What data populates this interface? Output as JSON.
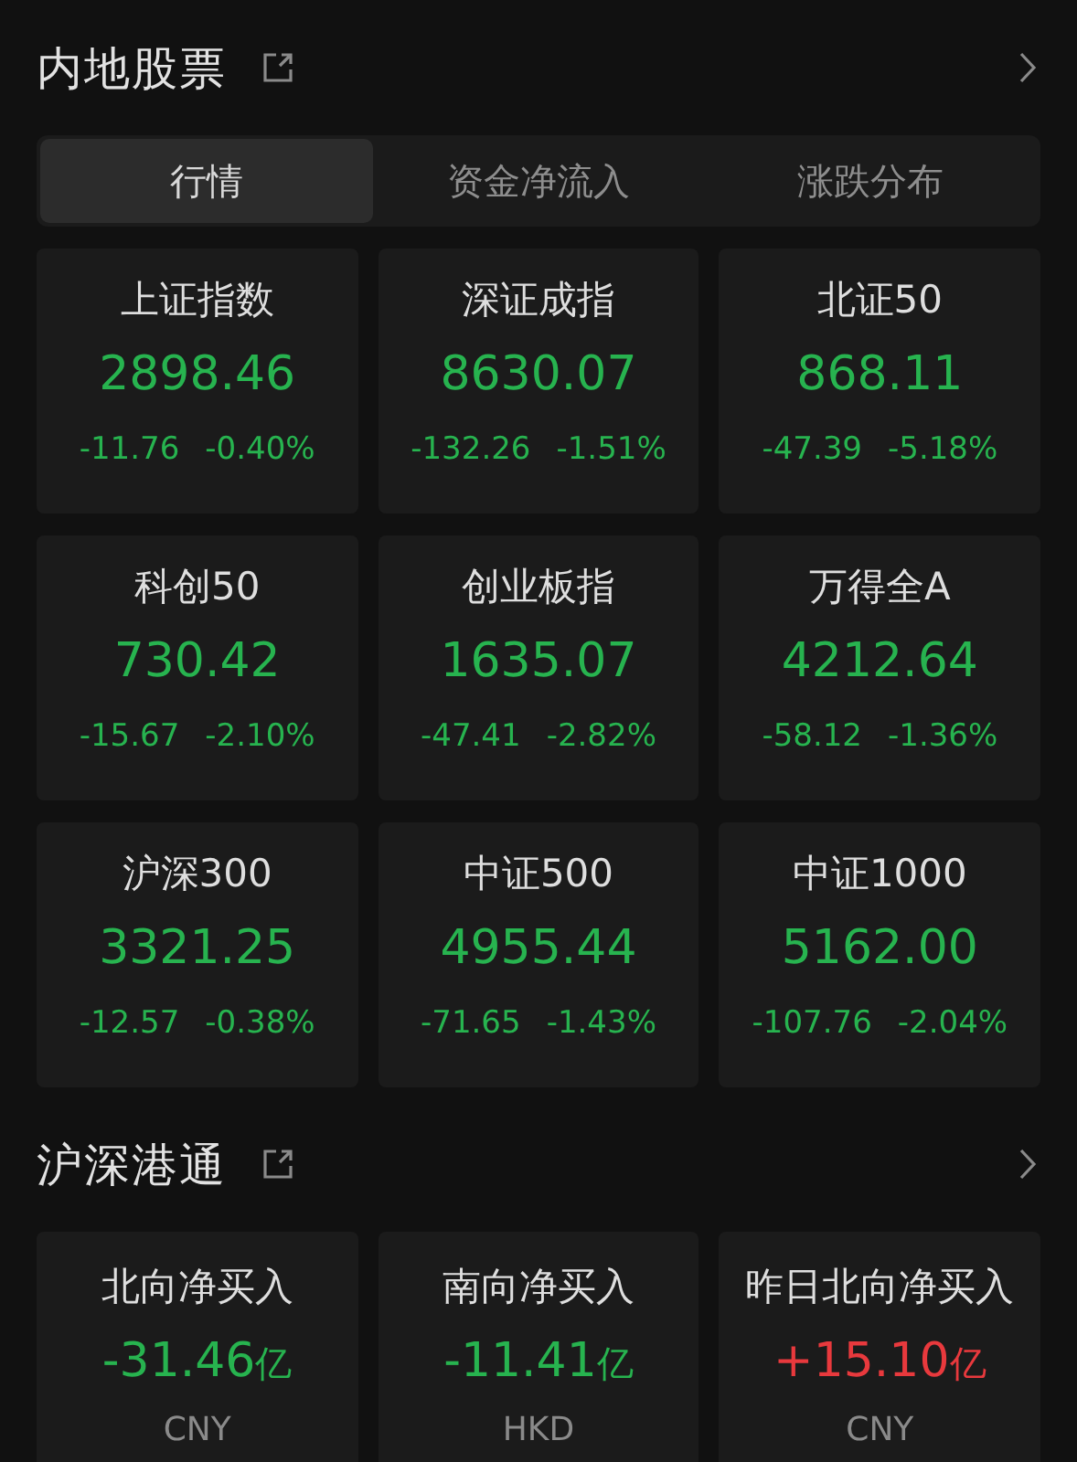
{
  "sections": [
    {
      "title": "内地股票",
      "tabs": [
        {
          "label": "行情",
          "selected": true
        },
        {
          "label": "资金净流入",
          "selected": false
        },
        {
          "label": "涨跌分布",
          "selected": false
        }
      ],
      "cards": [
        {
          "name": "上证指数",
          "value": "2898.46",
          "change": "-11.76",
          "percent": "-0.40%",
          "color": "#27b34f"
        },
        {
          "name": "深证成指",
          "value": "8630.07",
          "change": "-132.26",
          "percent": "-1.51%",
          "color": "#27b34f"
        },
        {
          "name": "北证50",
          "value": "868.11",
          "change": "-47.39",
          "percent": "-5.18%",
          "color": "#27b34f"
        },
        {
          "name": "科创50",
          "value": "730.42",
          "change": "-15.67",
          "percent": "-2.10%",
          "color": "#27b34f"
        },
        {
          "name": "创业板指",
          "value": "1635.07",
          "change": "-47.41",
          "percent": "-2.82%",
          "color": "#27b34f"
        },
        {
          "name": "万得全A",
          "value": "4212.64",
          "change": "-58.12",
          "percent": "-1.36%",
          "color": "#27b34f"
        },
        {
          "name": "沪深300",
          "value": "3321.25",
          "change": "-12.57",
          "percent": "-0.38%",
          "color": "#27b34f"
        },
        {
          "name": "中证500",
          "value": "4955.44",
          "change": "-71.65",
          "percent": "-1.43%",
          "color": "#27b34f"
        },
        {
          "name": "中证1000",
          "value": "5162.00",
          "change": "-107.76",
          "percent": "-2.04%",
          "color": "#27b34f"
        }
      ]
    },
    {
      "title": "沪深港通",
      "cards": [
        {
          "name": "北向净买入",
          "value": "-31.46",
          "unit": "亿",
          "currency": "CNY",
          "color": "#27b34f"
        },
        {
          "name": "南向净买入",
          "value": "-11.41",
          "unit": "亿",
          "currency": "HKD",
          "color": "#27b34f"
        },
        {
          "name": "昨日北向净买入",
          "value": "+15.10",
          "unit": "亿",
          "currency": "CNY",
          "color": "#e8393d"
        }
      ]
    }
  ]
}
